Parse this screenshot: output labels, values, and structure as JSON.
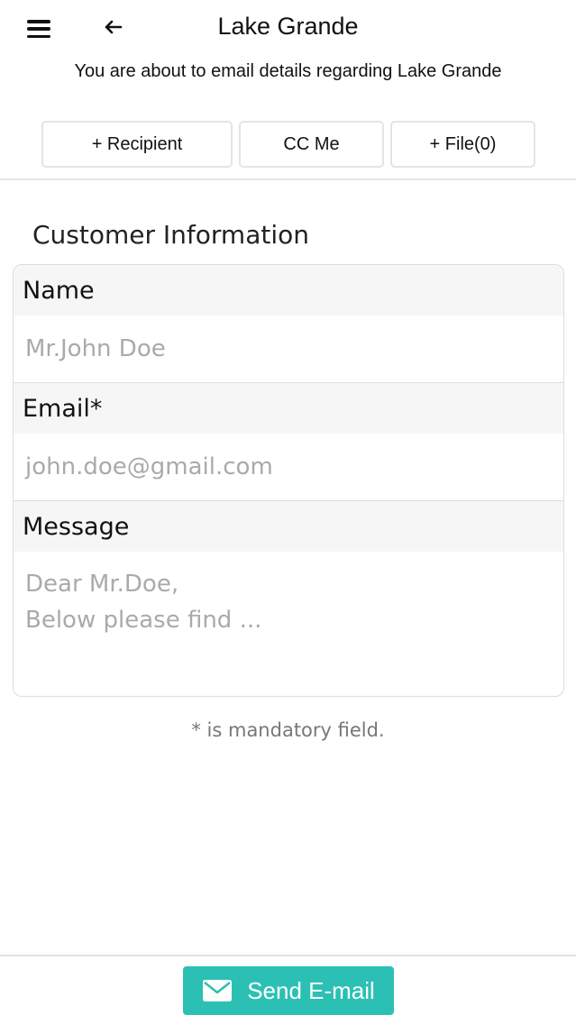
{
  "header": {
    "title": "Lake Grande",
    "subtitle": "You are about to email details regarding Lake Grande",
    "menu_icon": "hamburger-menu-icon",
    "back_icon": "arrow-left-icon"
  },
  "actions": {
    "recipient_label": "+ Recipient",
    "cc_label": "CC Me",
    "file_label": "+ File(0)"
  },
  "section": {
    "title": "Customer Information"
  },
  "form": {
    "name_label": "Name",
    "name_placeholder": "Mr.John Doe",
    "email_label": "Email*",
    "email_placeholder": "john.doe@gmail.com",
    "message_label": "Message",
    "message_placeholder_line1": "Dear Mr.Doe,",
    "message_placeholder_line2": "Below please find ..."
  },
  "note": "* is mandatory field.",
  "footer": {
    "send_label": "Send E-mail",
    "send_icon": "envelope-icon",
    "send_color": "#2cc0b4"
  }
}
